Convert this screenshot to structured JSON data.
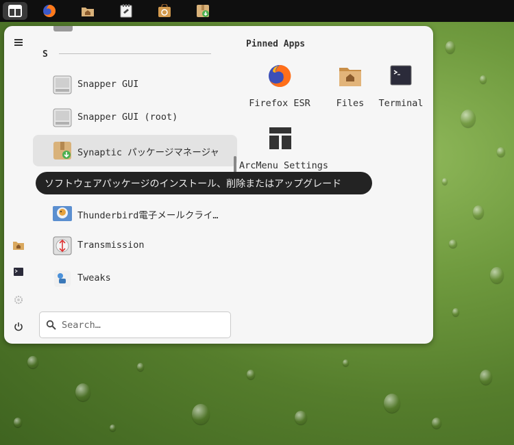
{
  "taskbar": {
    "items": [
      {
        "name": "arcmenu",
        "active": true
      },
      {
        "name": "firefox"
      },
      {
        "name": "files"
      },
      {
        "name": "gedit"
      },
      {
        "name": "software-center"
      },
      {
        "name": "synaptic"
      }
    ]
  },
  "sidebar": {
    "menu_icon": "hamburger-icon",
    "items": [
      "home-folder-icon",
      "terminal-icon",
      "settings-gear-icon",
      "power-icon"
    ]
  },
  "applist": {
    "section_letter": "S",
    "apps": [
      {
        "label": "Snapper GUI",
        "icon": "snapper-icon"
      },
      {
        "label": "Snapper GUI (root)",
        "icon": "snapper-icon"
      },
      {
        "label": "Synaptic パッケージマネージャ",
        "icon": "synaptic-icon",
        "hover": true
      },
      {
        "label": "Thunderbird電子メールクライ…",
        "icon": "thunderbird-icon"
      },
      {
        "label": "Transmission",
        "icon": "transmission-icon"
      },
      {
        "label": "Tweaks",
        "icon": "tweaks-icon"
      }
    ]
  },
  "tooltip": "ソフトウェアパッケージのインストール、削除またはアップグレード",
  "search": {
    "placeholder": "Search…",
    "value": ""
  },
  "pinned": {
    "title": "Pinned Apps",
    "apps": [
      {
        "label": "Firefox ESR",
        "icon": "firefox-icon"
      },
      {
        "label": "Files",
        "icon": "files-folder-icon"
      },
      {
        "label": "Terminal",
        "icon": "terminal-icon"
      },
      {
        "label": "ArcMenu Settings",
        "icon": "arcmenu-settings-icon"
      }
    ]
  }
}
